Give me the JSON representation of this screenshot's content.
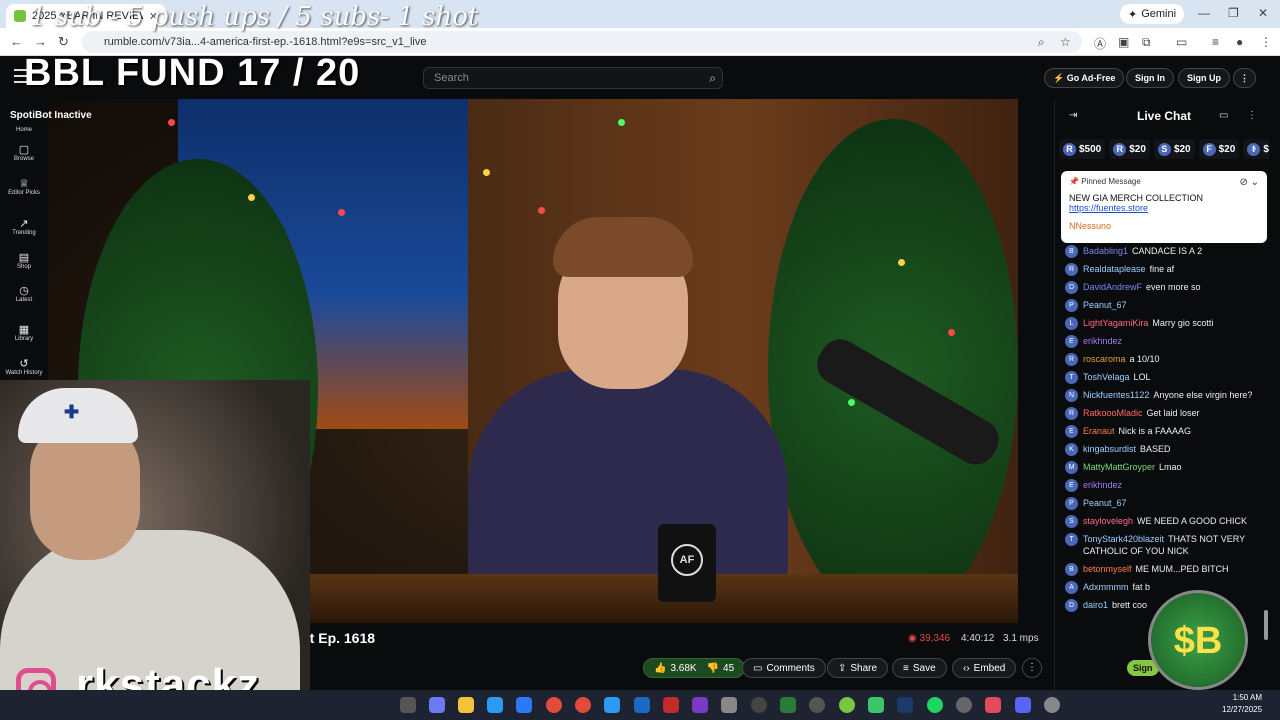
{
  "browser": {
    "tab_title": "2025 YEAR IN REVIEW | A...",
    "url": "rumble.com/v73ia...4-america-first-ep.-1618.html?e9s=src_v1_live",
    "gemini_label": "Gemini"
  },
  "overlay": {
    "top_text": "1 sub - 5 push ups / 5 subs- 1 shot",
    "fund_text": "BBL FUND  17 / 20",
    "handle": "rkstackz_",
    "spotibot": "SpotiBot Inactive",
    "sb_badge": "$B"
  },
  "header": {
    "search_placeholder": "Search",
    "go_ad_free": "Go Ad-Free",
    "sign_in": "Sign In",
    "sign_up": "Sign Up"
  },
  "sidebar": {
    "items": [
      {
        "label": "Home",
        "icon": "home-icon"
      },
      {
        "label": "Browse",
        "icon": "browse-icon"
      },
      {
        "label": "Editor Picks",
        "icon": "editor-picks-icon"
      },
      {
        "label": "Trending",
        "icon": "trending-icon"
      },
      {
        "label": "Shop",
        "icon": "shop-icon"
      },
      {
        "label": "Latest",
        "icon": "latest-icon"
      },
      {
        "label": "Library",
        "icon": "library-icon"
      },
      {
        "label": "Watch History",
        "icon": "history-icon"
      }
    ]
  },
  "video": {
    "title_visible": "First Ep. 1618",
    "mug_text": "AF",
    "views": "39,346",
    "duration": "4:40:12",
    "bitrate": "3.1 mps",
    "likes": "3.68K",
    "dislikes": "45",
    "comments_label": "Comments",
    "share_label": "Share",
    "save_label": "Save",
    "embed_label": "Embed"
  },
  "chat": {
    "title": "Live Chat",
    "rants": [
      {
        "letter": "R",
        "amount": "$500"
      },
      {
        "letter": "R",
        "amount": "$20"
      },
      {
        "letter": "S",
        "amount": "$20"
      },
      {
        "letter": "F",
        "amount": "$20"
      },
      {
        "letter": "I",
        "amount": "$"
      }
    ],
    "pinned": {
      "header": "Pinned Message",
      "text": "NEW GIA MERCH COLLECTION",
      "link": "https://fuentes.store",
      "user": "NNessuno"
    },
    "messages": [
      {
        "user": "Badabling1",
        "text": "CANDACE IS A 2",
        "color": "#7b86f5"
      },
      {
        "user": "Realdataplease",
        "text": "fine af",
        "color": "#9ad0ff"
      },
      {
        "user": "DavidAndrewF",
        "text": "even more so",
        "color": "#7b86f5"
      },
      {
        "user": "Peanut_67",
        "text": "",
        "color": "#9ad0ff"
      },
      {
        "user": "LightYagamiKira",
        "text": "Marry gio scotti",
        "color": "#ff6a8a"
      },
      {
        "user": "erikhndez",
        "text": "",
        "color": "#a07af5"
      },
      {
        "user": "roscaroma",
        "text": "a 10/10",
        "color": "#e3a03a"
      },
      {
        "user": "ToshVelaga",
        "text": "LOL",
        "color": "#9ad0ff"
      },
      {
        "user": "Nickfuentes1122",
        "text": "Anyone else virgin here?",
        "color": "#9ad0ff"
      },
      {
        "user": "RatkoooMladic",
        "text": "Get laid loser",
        "color": "#ff6a6a"
      },
      {
        "user": "Eranaut",
        "text": "Nick is a FAAAAG",
        "color": "#ff7a4a"
      },
      {
        "user": "kingabsurdist",
        "text": "BASED",
        "color": "#9ad0ff"
      },
      {
        "user": "MattyMattGroyper",
        "text": "Lmao",
        "color": "#7bd67b"
      },
      {
        "user": "erikhndez",
        "text": "",
        "color": "#a07af5"
      },
      {
        "user": "Peanut_67",
        "text": "",
        "color": "#9ad0ff"
      },
      {
        "user": "staylovelegh",
        "text": "WE NEED A GOOD CHICK",
        "color": "#ff6a8a"
      },
      {
        "user": "TonyStark420blazeit",
        "text": "THATS NOT VERY CATHOLIC OF YOU NICK",
        "color": "#9ad0ff"
      },
      {
        "user": "betonmyself",
        "text": "ME MUM...PED BITCH",
        "color": "#ff7a4a"
      },
      {
        "user": "Adxmmmm",
        "text": "fat b",
        "color": "#9ad0ff"
      },
      {
        "user": "dairo1",
        "text": "brett coo",
        "color": "#9ad0ff"
      }
    ],
    "sign_button": "Sign"
  },
  "taskbar": {
    "time": "1:50 AM",
    "date": "12/27/2025"
  }
}
